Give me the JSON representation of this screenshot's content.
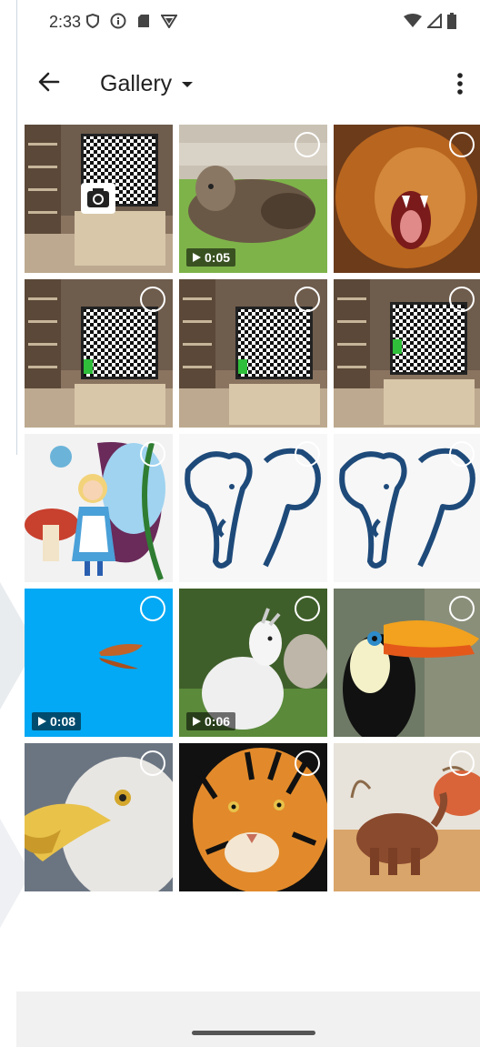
{
  "status": {
    "time": "2:33",
    "left_icons": [
      "shield-icon",
      "info-icon",
      "sd-card-icon",
      "vpn-icon"
    ],
    "right_icons": [
      "wifi-icon",
      "signal-icon",
      "battery-icon"
    ]
  },
  "app_bar": {
    "title": "Gallery",
    "back_icon": "back-arrow-icon",
    "dropdown_icon": "dropdown-arrow-icon",
    "more_icon": "more-vert-icon"
  },
  "gallery": {
    "items": [
      {
        "name": "camera-capture-tile",
        "content": "tv with checkerboard screen",
        "type": "camera"
      },
      {
        "name": "dog-video-tile",
        "content": "shaggy dog on grass",
        "type": "video",
        "duration": "0:05"
      },
      {
        "name": "lion-tile",
        "content": "roaring lion",
        "type": "image"
      },
      {
        "name": "tv-image-1-tile",
        "content": "tv with checkerboard",
        "type": "image"
      },
      {
        "name": "tv-image-2-tile",
        "content": "tv with checkerboard",
        "type": "image"
      },
      {
        "name": "tv-image-3-tile",
        "content": "tv with checkerboard",
        "type": "image"
      },
      {
        "name": "alice-tile",
        "content": "alice illustration",
        "type": "image"
      },
      {
        "name": "elephant-logo-1-tile",
        "content": "elephant logo",
        "type": "image"
      },
      {
        "name": "elephant-logo-2-tile",
        "content": "elephant logo",
        "type": "image"
      },
      {
        "name": "butterfly-video-tile",
        "content": "butterfly on blue",
        "type": "video",
        "duration": "0:08"
      },
      {
        "name": "goat-video-tile",
        "content": "white goat",
        "type": "video",
        "duration": "0:06"
      },
      {
        "name": "toucan-tile",
        "content": "toucan bird",
        "type": "image"
      },
      {
        "name": "eagle-tile",
        "content": "bald eagle",
        "type": "image"
      },
      {
        "name": "tiger-tile",
        "content": "tiger face",
        "type": "image"
      },
      {
        "name": "elephant-photo-tile",
        "content": "elephant in savanna",
        "type": "image"
      }
    ]
  },
  "colors": {
    "background": "#ffffff",
    "nav_bar": "#f1f1f1",
    "butterfly_bg": "#03a9f4",
    "logo_blue": "#1e4a7a"
  }
}
